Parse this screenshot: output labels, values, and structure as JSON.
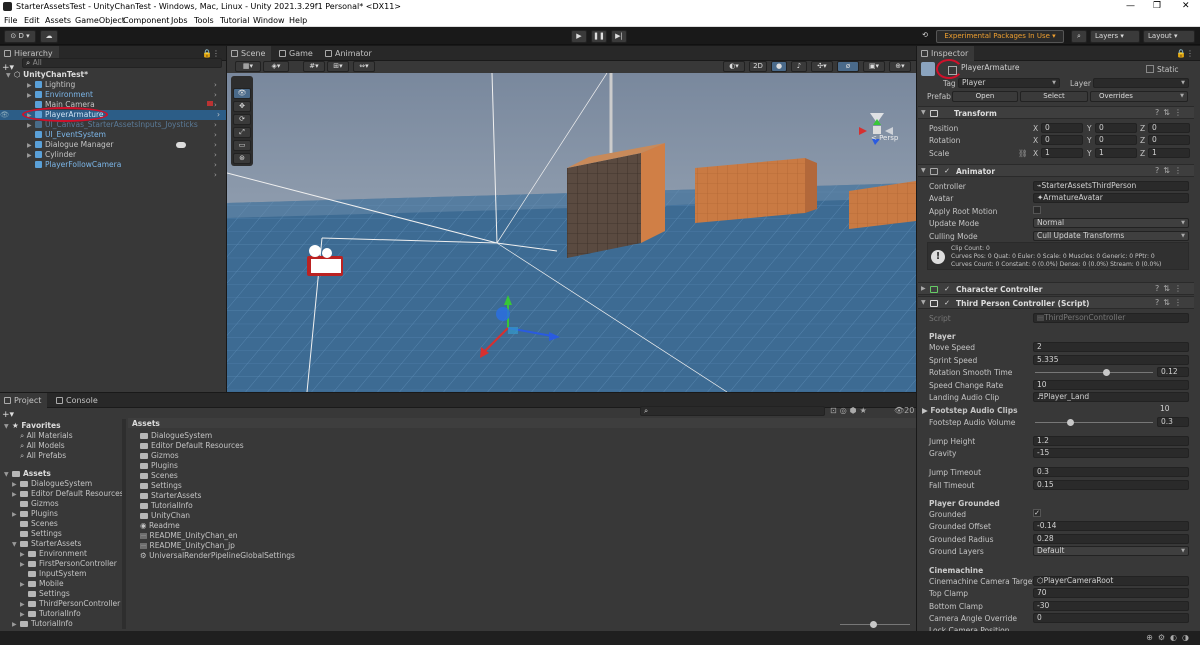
{
  "window": {
    "title": "StarterAssetsTest - UnityChanTest - Windows, Mac, Linux - Unity 2021.3.29f1 Personal* <DX11>",
    "controls": [
      "—",
      "❐",
      "✕"
    ]
  },
  "menu": [
    "File",
    "Edit",
    "Assets",
    "GameObject",
    "Component",
    "Jobs",
    "Tools",
    "Tutorial",
    "Window",
    "Help"
  ],
  "toolbar": {
    "account": "D",
    "experimental": "Experimental Packages In Use",
    "layers": "Layers",
    "layout": "Layout"
  },
  "hierarchy": {
    "tab": "Hierarchy",
    "search_placeholder": "All",
    "scene": "UnityChanTest*",
    "items": [
      {
        "label": "Lighting"
      },
      {
        "label": "Environment"
      },
      {
        "label": "Main Camera"
      },
      {
        "label": "PlayerArmature"
      },
      {
        "label": "UI_Canvas_StarterAssetsInputs_Joysticks"
      },
      {
        "label": "UI_EventSystem"
      },
      {
        "label": "Dialogue Manager"
      },
      {
        "label": "Cylinder"
      },
      {
        "label": "PlayerFollowCamera"
      }
    ]
  },
  "scene_view": {
    "tabs": [
      "Scene",
      "Game",
      "Animator"
    ],
    "mode_2d": "2D",
    "persp": "< Persp"
  },
  "project": {
    "tabs": [
      "Project",
      "Console"
    ],
    "favorites_title": "Favorites",
    "favorites": [
      "All Materials",
      "All Models",
      "All Prefabs"
    ],
    "assets_title": "Assets",
    "tree": [
      {
        "label": "DialogueSystem"
      },
      {
        "label": "Editor Default Resources"
      },
      {
        "label": "Gizmos"
      },
      {
        "label": "Plugins"
      },
      {
        "label": "Scenes"
      },
      {
        "label": "Settings"
      },
      {
        "label": "StarterAssets"
      },
      {
        "label": "Environment"
      },
      {
        "label": "FirstPersonController"
      },
      {
        "label": "InputSystem"
      },
      {
        "label": "Mobile"
      },
      {
        "label": "Settings"
      },
      {
        "label": "ThirdPersonController"
      },
      {
        "label": "TutorialInfo"
      },
      {
        "label": "TutorialInfo"
      }
    ],
    "breadcrumb": "Assets",
    "files": [
      {
        "label": "DialogueSystem",
        "kind": "folder"
      },
      {
        "label": "Editor Default Resources",
        "kind": "folder"
      },
      {
        "label": "Gizmos",
        "kind": "folder"
      },
      {
        "label": "Plugins",
        "kind": "folder"
      },
      {
        "label": "Scenes",
        "kind": "folder"
      },
      {
        "label": "Settings",
        "kind": "folder"
      },
      {
        "label": "StarterAssets",
        "kind": "folder"
      },
      {
        "label": "TutorialInfo",
        "kind": "folder"
      },
      {
        "label": "UnityChan",
        "kind": "folder"
      },
      {
        "label": "Readme",
        "kind": "asset"
      },
      {
        "label": "README_UnityChan_en",
        "kind": "doc"
      },
      {
        "label": "README_UnityChan_jp",
        "kind": "doc"
      },
      {
        "label": "UniversalRenderPipelineGlobalSettings",
        "kind": "asset"
      }
    ],
    "count": "20"
  },
  "inspector": {
    "tab": "Inspector",
    "object_name": "PlayerArmature",
    "static_label": "Static",
    "tag_label": "Tag",
    "tag_value": "Player",
    "layer_label": "Layer",
    "prefab_label": "Prefab",
    "open": "Open",
    "select": "Select",
    "overrides": "Overrides",
    "transform": {
      "title": "Transform",
      "rows": [
        {
          "label": "Position",
          "x": "0",
          "y": "0",
          "z": "0"
        },
        {
          "label": "Rotation",
          "x": "0",
          "y": "0",
          "z": "0"
        },
        {
          "label": "Scale",
          "x": "1",
          "y": "1",
          "z": "1"
        }
      ],
      "axis": [
        "X",
        "Y",
        "Z"
      ]
    },
    "animator": {
      "title": "Animator",
      "controller_label": "Controller",
      "controller": "StarterAssetsThirdPerson",
      "avatar_label": "Avatar",
      "avatar": "ArmatureAvatar",
      "root_motion_label": "Apply Root Motion",
      "update_label": "Update Mode",
      "update": "Normal",
      "culling_label": "Culling Mode",
      "culling": "Cull Update Transforms",
      "info1": "Clip Count: 0",
      "info2": "Curves Pos: 0 Quat: 0 Euler: 0 Scale: 0 Muscles: 0 Generic: 0 PPtr: 0",
      "info3": "Curves Count: 0 Constant: 0 (0.0%) Dense: 0 (0.0%) Stream: 0 (0.0%)"
    },
    "char_controller": "Character Controller",
    "tpc": {
      "title": "Third Person Controller (Script)",
      "script_label": "Script",
      "script": "ThirdPersonController",
      "player": "Player",
      "move_speed_label": "Move Speed",
      "move_speed": "2",
      "sprint_label": "Sprint Speed",
      "sprint": "5.335",
      "rot_label": "Rotation Smooth Time",
      "rot": "0.12",
      "rot_level": 0.6,
      "change_label": "Speed Change Rate",
      "change": "10",
      "landing_label": "Landing Audio Clip",
      "landing": "Player_Land",
      "footsteps_label": "Footstep Audio Clips",
      "footsteps": "10",
      "fvol_label": "Footstep Audio Volume",
      "fvol": "0.3",
      "fvol_level": 0.3,
      "jump_label": "Jump Height",
      "jump": "1.2",
      "gravity_label": "Gravity",
      "gravity": "-15",
      "jt_label": "Jump Timeout",
      "jt": "0.3",
      "ft_label": "Fall Timeout",
      "ft": "0.15",
      "grounded_title": "Player Grounded",
      "grounded_label": "Grounded",
      "goff_label": "Grounded Offset",
      "goff": "-0.14",
      "grad_label": "Grounded Radius",
      "grad": "0.28",
      "glayers_label": "Ground Layers",
      "glayers": "Default",
      "cine_title": "Cinemachine",
      "cam_target_label": "Cinemachine Camera Target",
      "cam_target": "PlayerCameraRoot",
      "top_label": "Top Clamp",
      "top": "70",
      "bottom_label": "Bottom Clamp",
      "bottom": "-30",
      "override_label": "Camera Angle Override",
      "override": "0",
      "lock_label": "Lock Camera Position"
    }
  },
  "colors": {
    "accent": "#2c5d87",
    "highlight_ring": "#d0102a",
    "sky": "#8fa0b4",
    "ground": "#3f6c92"
  }
}
